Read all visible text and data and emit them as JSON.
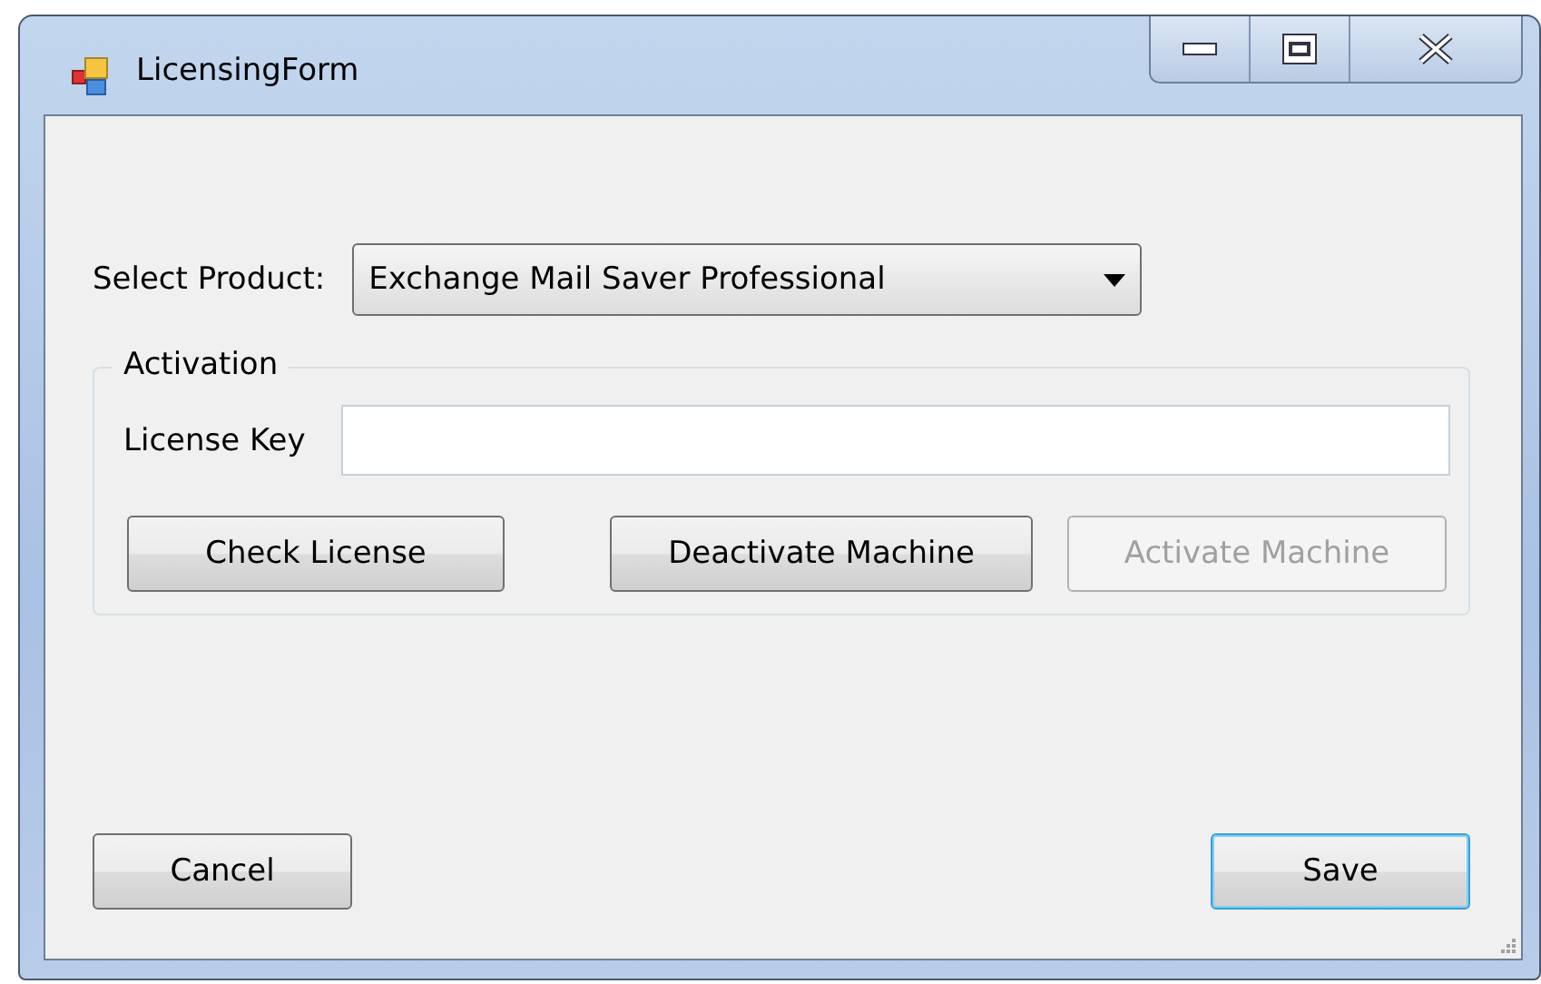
{
  "window": {
    "title": "LicensingForm",
    "controls": [
      {
        "kind": "minimize"
      },
      {
        "kind": "maximize"
      },
      {
        "kind": "close"
      }
    ]
  },
  "product": {
    "label": "Select Product:",
    "value": "Exchange Mail Saver Professional"
  },
  "activation": {
    "legend": "Activation",
    "license_key_label": "License Key",
    "buttons": [
      {
        "label": "Check License",
        "disabled": false
      },
      {
        "label": "Deactivate Machine",
        "disabled": false
      },
      {
        "label": "Activate Machine",
        "disabled": true
      }
    ]
  },
  "footer_buttons": [
    {
      "label": "Cancel",
      "focused": false
    },
    {
      "label": "Save",
      "focused": true
    }
  ]
}
